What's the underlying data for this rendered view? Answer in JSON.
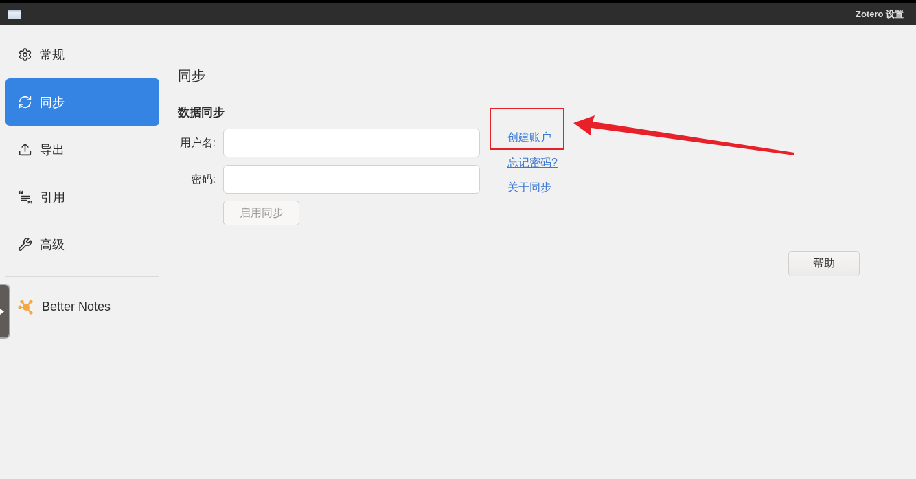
{
  "window": {
    "title": "Zotero 设置"
  },
  "sidebar": {
    "items": [
      {
        "label": "常规",
        "selected": false
      },
      {
        "label": "同步",
        "selected": true
      },
      {
        "label": "导出",
        "selected": false
      },
      {
        "label": "引用",
        "selected": false
      },
      {
        "label": "高级",
        "selected": false
      }
    ],
    "plugins": [
      {
        "label": "Better Notes",
        "selected": false
      }
    ]
  },
  "page": {
    "title": "同步",
    "section": "数据同步",
    "fields": [
      {
        "label": "用户名:"
      },
      {
        "label": "密码:"
      }
    ],
    "enable_button": {
      "label": "启用同步",
      "disabled": true
    },
    "links": [
      "创建账户",
      "忘记密码?",
      "关于同步"
    ],
    "help_button": "帮助"
  }
}
